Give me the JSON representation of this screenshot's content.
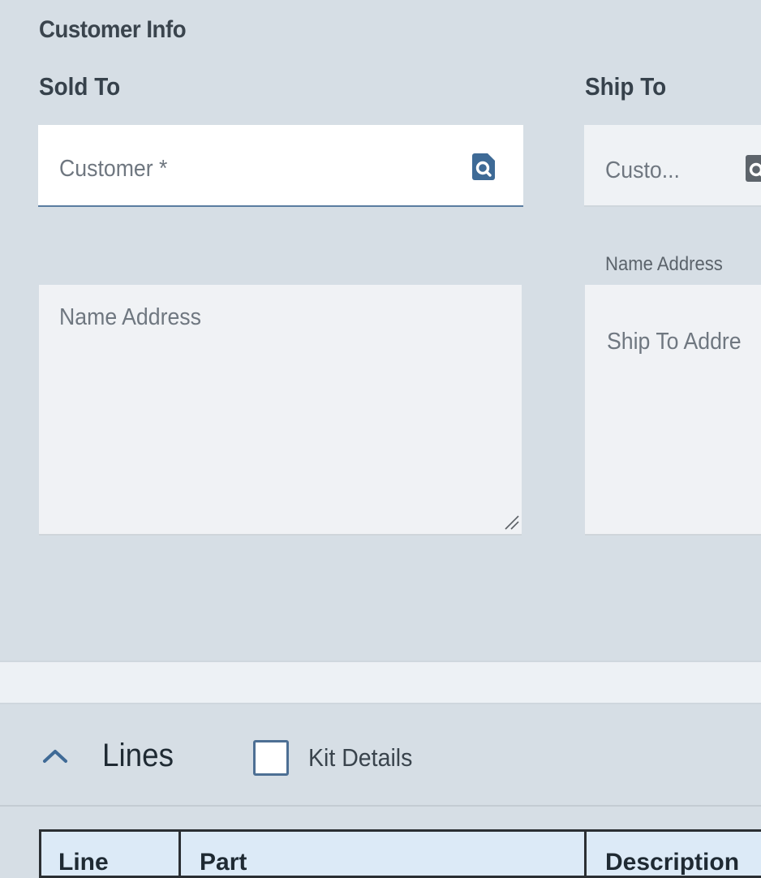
{
  "section": {
    "title": "Customer Info"
  },
  "sold_to": {
    "title": "Sold To",
    "customer_placeholder": "Customer *",
    "address_placeholder": "Name Address"
  },
  "ship_to": {
    "title": "Ship To",
    "customer_placeholder": "Custo...",
    "address_label": "Name Address",
    "address_placeholder": "Ship To Addre"
  },
  "lines": {
    "title": "Lines",
    "kit_details_label": "Kit Details",
    "kit_details_checked": false,
    "columns": [
      "Line",
      "Part",
      "Description"
    ]
  },
  "colors": {
    "background": "#d6dee5",
    "field": "#ffffff",
    "accent": "#4d6f94",
    "table_header": "#dceaf7"
  }
}
